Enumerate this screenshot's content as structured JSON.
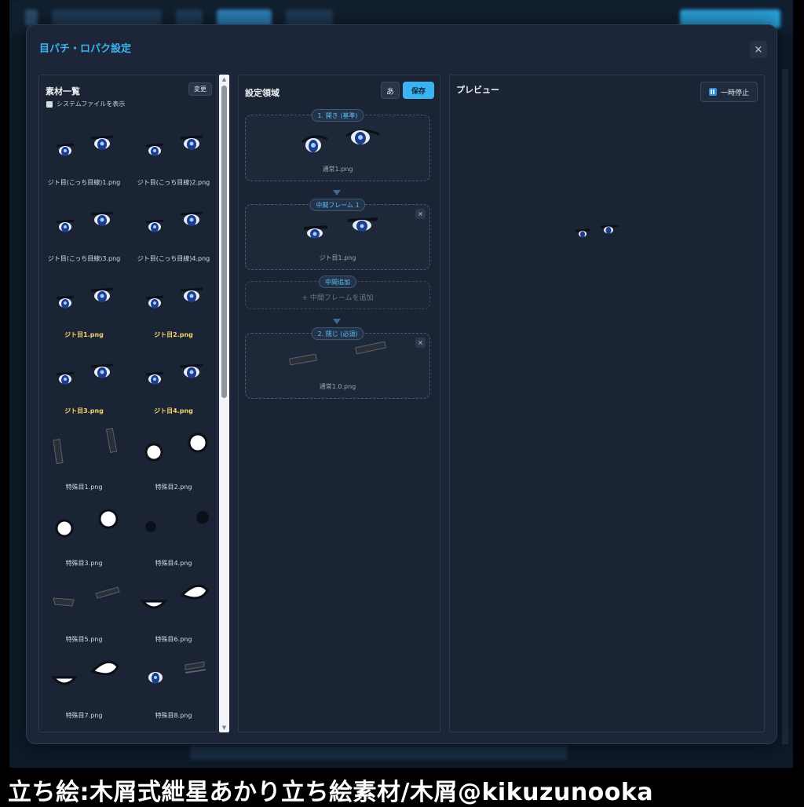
{
  "modal": {
    "title": "目パチ・ロパク設定",
    "close_label": "×"
  },
  "left_panel": {
    "title": "素材一覧",
    "change_label": "変更",
    "show_system_label": "システムファイルを表示",
    "items": [
      {
        "label": "ジト目(こっち目線)1.png",
        "selected": false,
        "art": "eyes"
      },
      {
        "label": "ジト目(こっち目線)2.png",
        "selected": false,
        "art": "eyes"
      },
      {
        "label": "ジト目(こっち目線)3.png",
        "selected": false,
        "art": "eyes"
      },
      {
        "label": "ジト目(こっち目線)4.png",
        "selected": false,
        "art": "eyes"
      },
      {
        "label": "ジト目1.png",
        "selected": true,
        "art": "eyes"
      },
      {
        "label": "ジト目2.png",
        "selected": true,
        "art": "eyes"
      },
      {
        "label": "ジト目3.png",
        "selected": true,
        "art": "eyes"
      },
      {
        "label": "ジト目4.png",
        "selected": true,
        "art": "eyes"
      },
      {
        "label": "特殊目1.png",
        "selected": false,
        "art": "bars"
      },
      {
        "label": "特殊目2.png",
        "selected": false,
        "art": "white-circles"
      },
      {
        "label": "特殊目3.png",
        "selected": false,
        "art": "white-circles"
      },
      {
        "label": "特殊目4.png",
        "selected": false,
        "art": "dark-dots"
      },
      {
        "label": "特殊目5.png",
        "selected": false,
        "art": "closed-lines"
      },
      {
        "label": "特殊目6.png",
        "selected": false,
        "art": "half-white"
      },
      {
        "label": "特殊目7.png",
        "selected": false,
        "art": "half-white"
      },
      {
        "label": "特殊目8.png",
        "selected": false,
        "art": "mixed"
      }
    ]
  },
  "mid_panel": {
    "title": "設定領域",
    "lang_button": "あ",
    "save_button": "保存",
    "frames": [
      {
        "tag": "1. 開き (基準)",
        "file": "通常1.png"
      },
      {
        "tag": "中間フレーム 1",
        "file": "ジト目1.png",
        "remove": "×"
      },
      {
        "tag": "2. 閉じ (必須)",
        "file": "通常1.0.png",
        "remove": "×"
      }
    ],
    "add_tag": "中間追加",
    "add_text": "+ 中間フレームを追加"
  },
  "right_panel": {
    "title": "プレビュー",
    "pause_button": "一時停止"
  },
  "credit": "立ち絵:木屑式紲星あかり立ち絵素材/木屑@kikuzunooka",
  "colors": {
    "accent": "#3ab3f0",
    "selected_text": "#f0d466",
    "panel_bg": "#1a2434"
  }
}
